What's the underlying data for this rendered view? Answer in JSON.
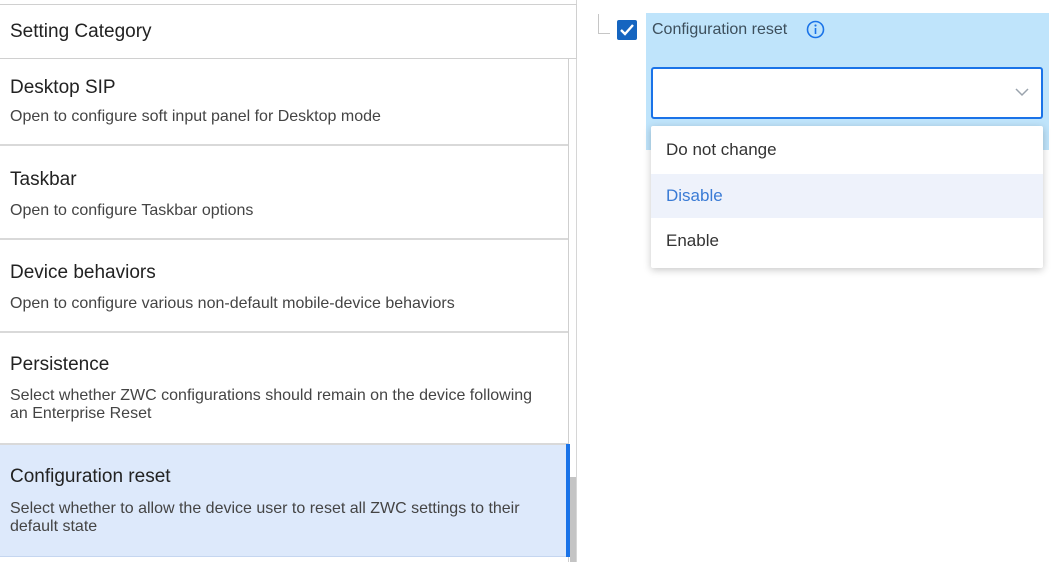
{
  "category_panel": {
    "header": "Setting Category",
    "items": [
      {
        "title": "Desktop SIP",
        "desc": "Open to configure soft input panel for Desktop mode"
      },
      {
        "title": "Taskbar",
        "desc": "Open to configure Taskbar options"
      },
      {
        "title": "Device behaviors",
        "desc": "Open to configure various non-default mobile-device behaviors"
      },
      {
        "title": "Persistence",
        "desc": "Select whether ZWC configurations should remain on the device following an Enterprise Reset"
      },
      {
        "title": "Configuration reset",
        "desc": "Select whether to allow the device user to reset all ZWC settings to their default state",
        "selected": true
      }
    ]
  },
  "setting": {
    "label": "Configuration reset",
    "checked": true,
    "info_icon": "info-icon",
    "select_value": "",
    "options": [
      "Do not change",
      "Disable",
      "Enable"
    ],
    "highlighted_option": "Disable"
  },
  "colors": {
    "accent": "#1a73e8",
    "selected_row": "#dde9fb",
    "setting_highlight": "#bfe4fb",
    "checkbox": "#1565c0"
  }
}
